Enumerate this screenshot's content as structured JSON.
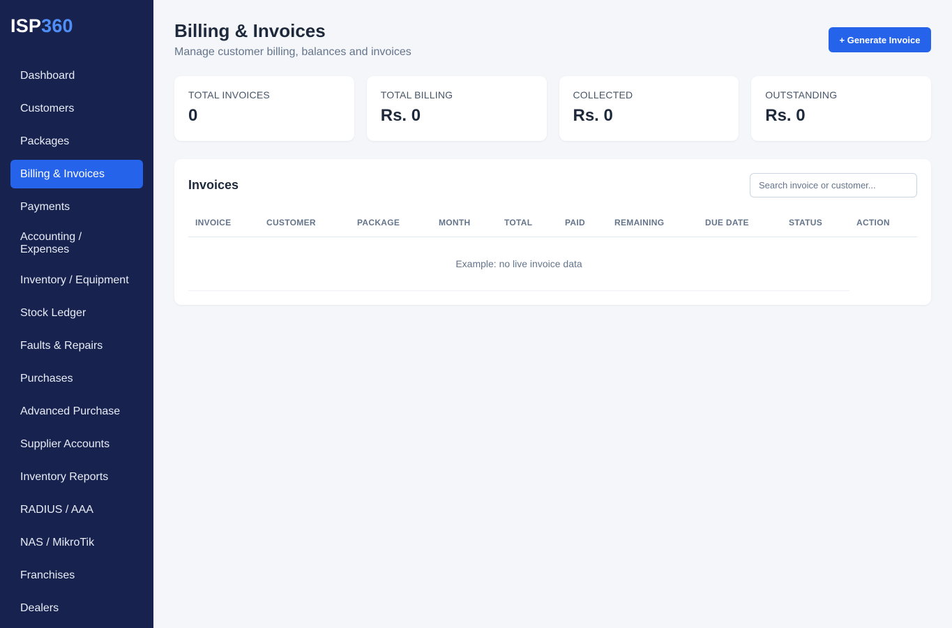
{
  "brand": {
    "prefix": "ISP",
    "suffix": "360"
  },
  "sidebar": {
    "items": [
      {
        "label": "Dashboard"
      },
      {
        "label": "Customers"
      },
      {
        "label": "Packages"
      },
      {
        "label": "Billing & Invoices",
        "active": true
      },
      {
        "label": "Payments"
      },
      {
        "label": "Accounting / Expenses"
      },
      {
        "label": "Inventory / Equipment"
      },
      {
        "label": "Stock Ledger"
      },
      {
        "label": "Faults & Repairs"
      },
      {
        "label": "Purchases"
      },
      {
        "label": "Advanced Purchase"
      },
      {
        "label": "Supplier Accounts"
      },
      {
        "label": "Inventory Reports"
      },
      {
        "label": "RADIUS / AAA"
      },
      {
        "label": "NAS / MikroTik"
      },
      {
        "label": "Franchises"
      },
      {
        "label": "Dealers"
      }
    ]
  },
  "header": {
    "title": "Billing & Invoices",
    "subtitle": "Manage customer billing, balances and invoices",
    "generate_label": "+ Generate Invoice"
  },
  "stats": [
    {
      "label": "TOTAL INVOICES",
      "value": "0"
    },
    {
      "label": "TOTAL BILLING",
      "value": "Rs. 0"
    },
    {
      "label": "COLLECTED",
      "value": "Rs. 0"
    },
    {
      "label": "OUTSTANDING",
      "value": "Rs. 0"
    }
  ],
  "invoices": {
    "title": "Invoices",
    "search_placeholder": "Search invoice or customer...",
    "columns": [
      "INVOICE",
      "CUSTOMER",
      "PACKAGE",
      "MONTH",
      "TOTAL",
      "PAID",
      "REMAINING",
      "DUE DATE",
      "STATUS",
      "ACTION"
    ],
    "empty_text": "Example: no live invoice data"
  },
  "colors": {
    "sidebar_bg": "#17224f",
    "accent": "#2563eb",
    "logo_accent": "#4f8ff7",
    "page_bg": "#f4f6fa"
  }
}
